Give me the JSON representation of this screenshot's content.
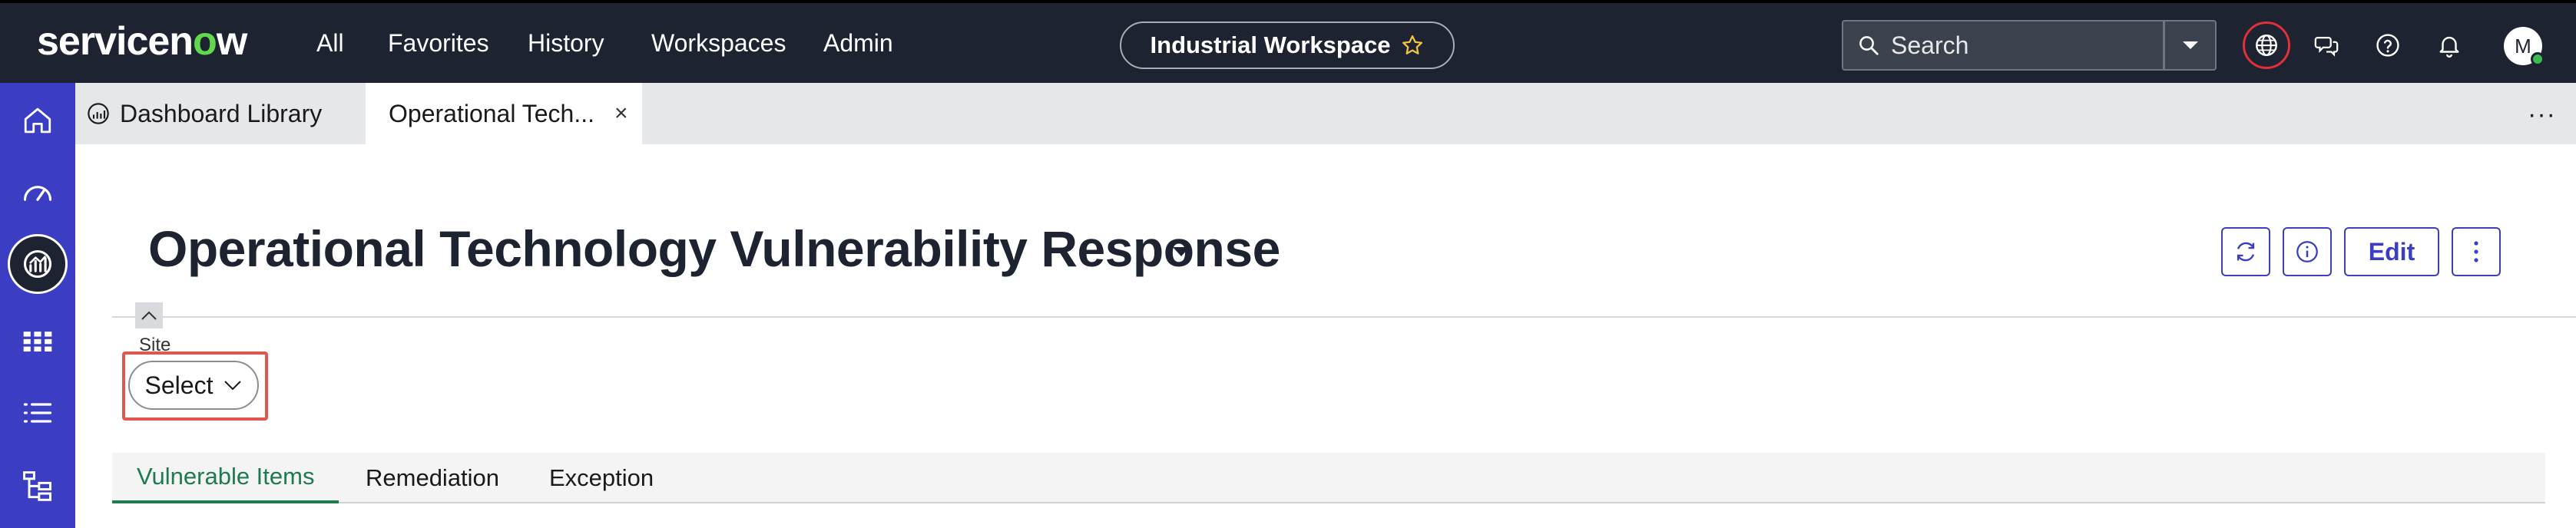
{
  "header": {
    "logo_prefix": "servicen",
    "logo_o": "o",
    "logo_suffix": "w",
    "nav": [
      "All",
      "Favorites",
      "History",
      "Workspaces",
      "Admin"
    ],
    "workspace_pill": "Industrial Workspace",
    "search_placeholder": "Search",
    "avatar_initial": "M",
    "icons": [
      "globe-icon",
      "chat-icon",
      "help-icon",
      "bell-icon"
    ]
  },
  "rail": {
    "items": [
      "home-icon",
      "dashboard-gauge-icon",
      "analytics-icon",
      "grid-icon",
      "list-icon",
      "hierarchy-icon"
    ],
    "active_index": 2
  },
  "tabs": {
    "items": [
      {
        "label": "Dashboard Library"
      },
      {
        "label": "Operational Tech...",
        "closable": true
      }
    ],
    "close_glyph": "×",
    "more_glyph": "···"
  },
  "page": {
    "title": "Operational Technology Vulnerability Response",
    "edit_label": "Edit"
  },
  "filter": {
    "label": "Site",
    "select_value": "Select"
  },
  "content_tabs": [
    {
      "label": "Vulnerable Items",
      "active": true
    },
    {
      "label": "Remediation",
      "active": false
    },
    {
      "label": "Exception",
      "active": false
    }
  ],
  "colors": {
    "topnav_bg": "#1d2330",
    "rail_bg": "#3b3ec2",
    "accent": "#3b3ec2",
    "active_tab": "#1e7a4f",
    "highlight": "#e0574f",
    "logo_o": "#62d84e"
  }
}
